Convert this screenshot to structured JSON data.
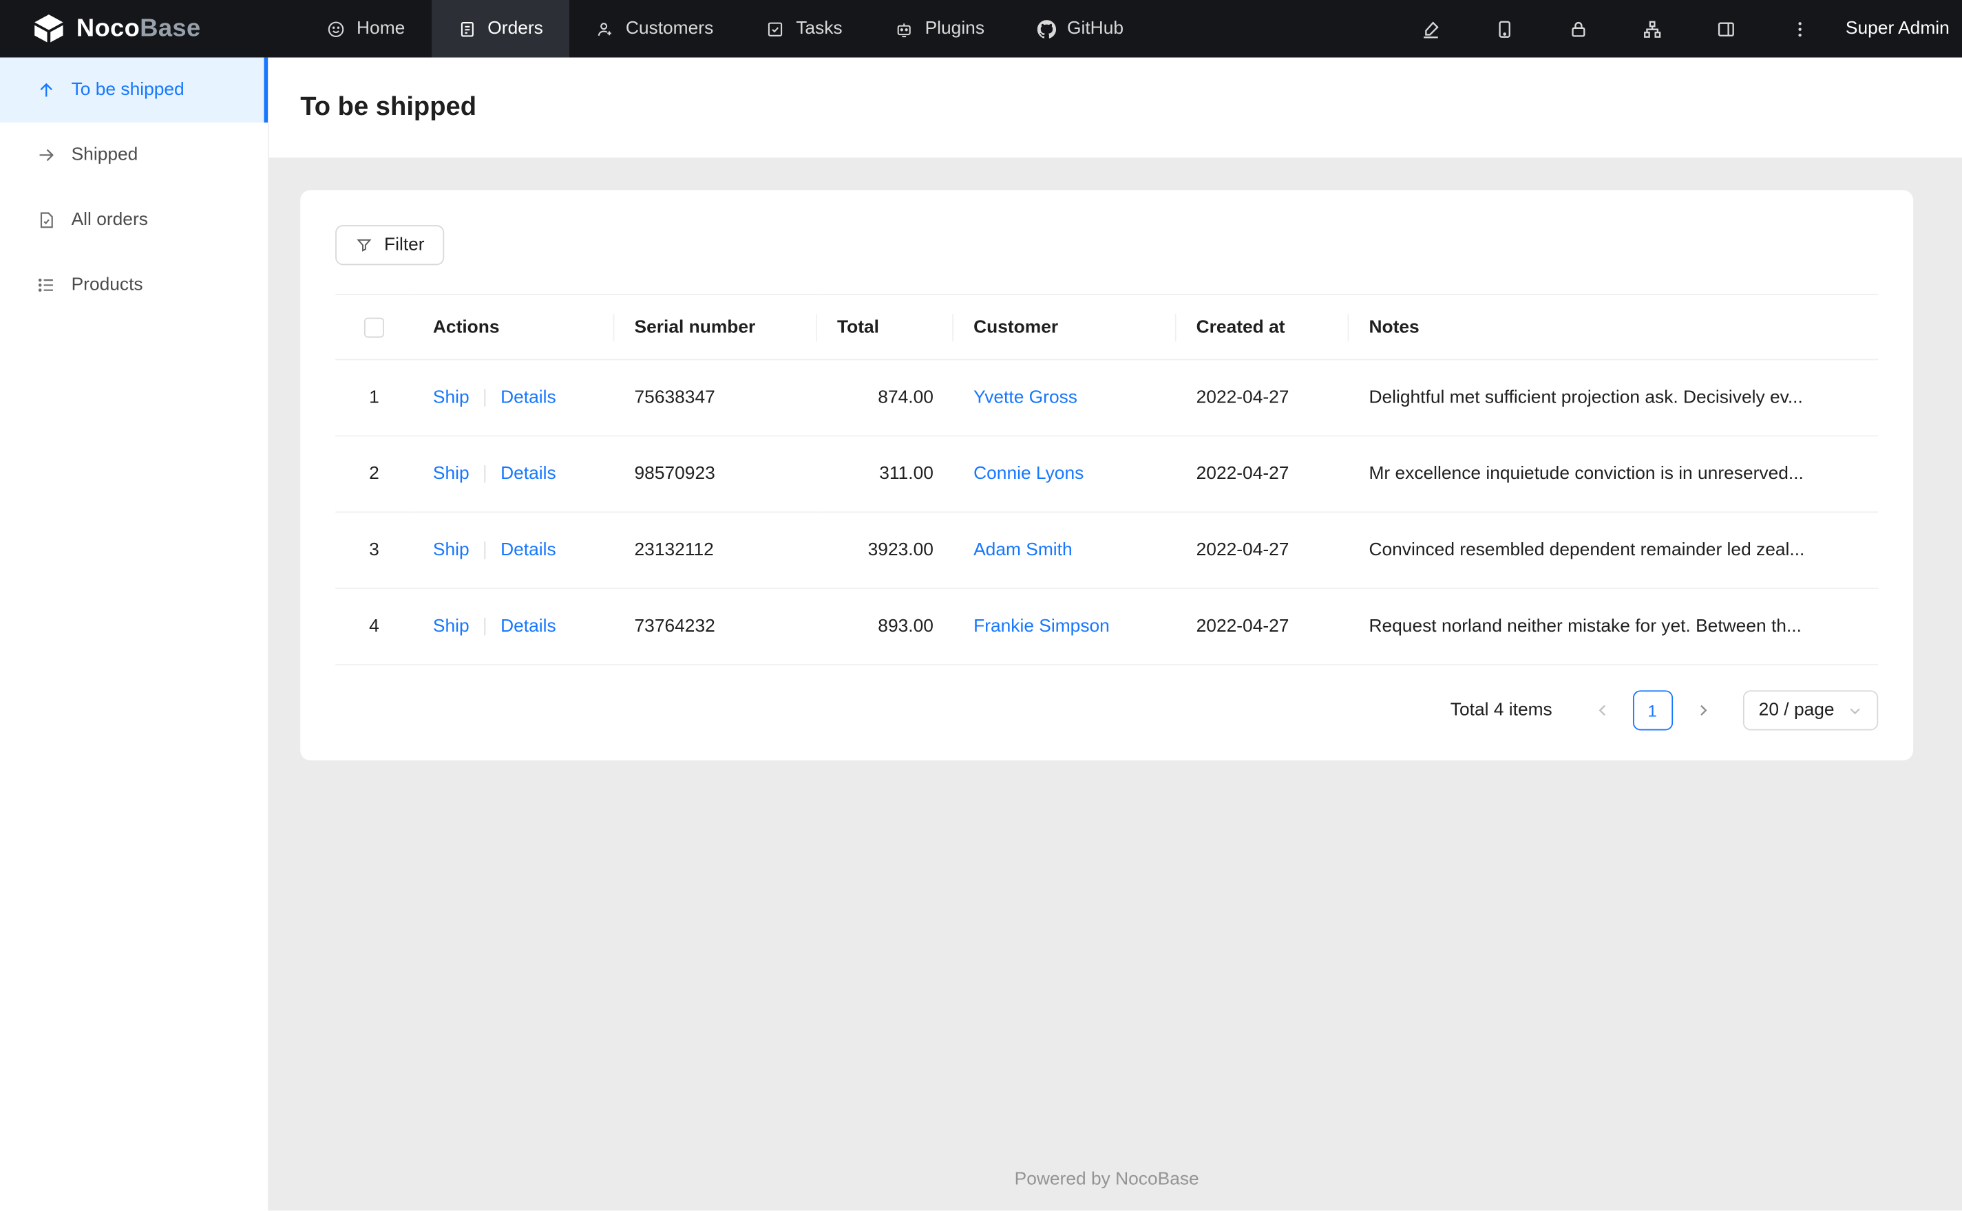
{
  "topbar": {
    "logo_text_primary": "Noco",
    "logo_text_secondary": "Base",
    "nav": [
      {
        "label": "Home",
        "icon": "home-icon"
      },
      {
        "label": "Orders",
        "icon": "orders-icon"
      },
      {
        "label": "Customers",
        "icon": "customers-icon"
      },
      {
        "label": "Tasks",
        "icon": "tasks-icon"
      },
      {
        "label": "Plugins",
        "icon": "plugins-icon"
      },
      {
        "label": "GitHub",
        "icon": "github-icon"
      }
    ],
    "user_name": "Super Admin"
  },
  "sidebar": {
    "items": [
      {
        "label": "To be shipped",
        "icon": "arrow-up-icon",
        "active": true
      },
      {
        "label": "Shipped",
        "icon": "arrow-right-icon",
        "active": false
      },
      {
        "label": "All orders",
        "icon": "file-icon",
        "active": false
      },
      {
        "label": "Products",
        "icon": "list-icon",
        "active": false
      }
    ]
  },
  "page": {
    "title": "To be shipped"
  },
  "toolbar": {
    "filter_label": "Filter"
  },
  "table": {
    "columns": [
      "Actions",
      "Serial number",
      "Total",
      "Customer",
      "Created at",
      "Notes"
    ],
    "rows": [
      {
        "index": "1",
        "action_ship": "Ship",
        "action_details": "Details",
        "serial_number": "75638347",
        "total": "874.00",
        "customer": "Yvette Gross",
        "created_at": "2022-04-27",
        "notes": "Delightful met sufficient projection ask. Decisively ev..."
      },
      {
        "index": "2",
        "action_ship": "Ship",
        "action_details": "Details",
        "serial_number": "98570923",
        "total": "311.00",
        "customer": "Connie Lyons",
        "created_at": "2022-04-27",
        "notes": "Mr excellence inquietude conviction is in unreserved..."
      },
      {
        "index": "3",
        "action_ship": "Ship",
        "action_details": "Details",
        "serial_number": "23132112",
        "total": "3923.00",
        "customer": "Adam Smith",
        "created_at": "2022-04-27",
        "notes": "Convinced resembled dependent remainder led zeal..."
      },
      {
        "index": "4",
        "action_ship": "Ship",
        "action_details": "Details",
        "serial_number": "73764232",
        "total": "893.00",
        "customer": "Frankie Simpson",
        "created_at": "2022-04-27",
        "notes": "Request norland neither mistake for yet. Between th..."
      }
    ]
  },
  "pagination": {
    "total_text": "Total 4 items",
    "current_page": "1",
    "page_size": "20 / page"
  },
  "footer": {
    "text": "Powered by NocoBase"
  },
  "colors": {
    "accent": "#1677ff",
    "topbar_bg": "#141619",
    "active_nav_bg": "#2c3036",
    "active_sidebar_bg": "#e7f4ff",
    "content_bg": "#ebebeb",
    "border": "#f0f0f0"
  }
}
